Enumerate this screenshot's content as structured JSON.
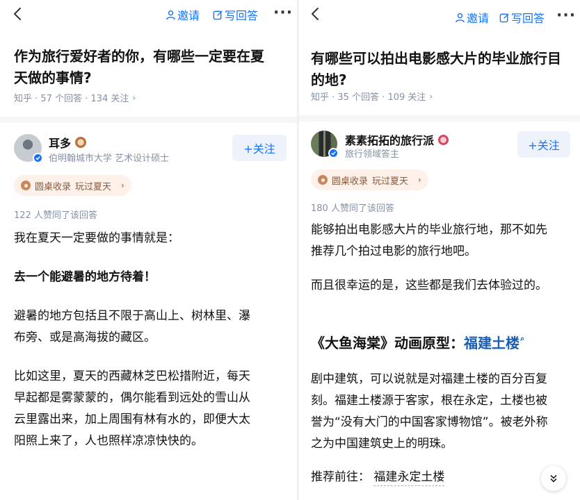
{
  "left": {
    "toolbar": {
      "invite_label": "邀请",
      "write_label": "写回答",
      "more_label": "···"
    },
    "question": {
      "title_line1": "作为旅行爱好者的你，有哪些一定要在夏",
      "title_line2": "天做的事情?",
      "meta": "知乎 · 57 个回答 · 134 关注"
    },
    "author": {
      "name": "耳多",
      "subtitle": "伯明翰城市大学 艺术设计硕士",
      "follow_label": "+关注"
    },
    "collection": {
      "label": "圆桌收录",
      "topic": "玩过夏天"
    },
    "likes": "122 人赞同了该回答",
    "answer": {
      "p1": "我在夏天一定要做的事情就是：",
      "p2": "去一个能避暑的地方待着！",
      "p3_line1": "避暑的地方包括且不限于高山上、树林里、瀑",
      "p3_line2": "布旁、或是高海拔的藏区。",
      "p4_line1": "比如这里，夏天的西藏林芝巴松措附近，每天",
      "p4_line2": "早起都是雾蒙蒙的，偶尔能看到远处的雪山从",
      "p4_line3": "云里露出来，加上周围有林有水的，即便大太",
      "p4_line4": "阳照上来了，人也照样凉凉快快的。"
    }
  },
  "right": {
    "toolbar": {
      "invite_label": "邀请",
      "write_label": "写回答",
      "more_label": "···"
    },
    "question": {
      "title_line1": "有哪些可以拍出电影感大片的毕业旅行目",
      "title_line2": "的地?",
      "meta": "知乎 · 35 个回答 · 109 关注"
    },
    "author": {
      "name": "素素拓拓的旅行派",
      "subtitle": "旅行领域答主",
      "follow_label": "+关注"
    },
    "collection": {
      "label": "圆桌收录",
      "topic": "玩过夏天"
    },
    "likes": "180 人赞同了该回答",
    "answer": {
      "p1_line1": "能够拍出电影感大片的毕业旅行地，那不如先",
      "p1_line2": "推荐几个拍过电影的旅行地吧。",
      "p2": "而且很幸运的是，这些都是我们去体验过的。",
      "heading_prefix": "《大鱼海棠》动画原型：",
      "heading_link": "福建土楼",
      "p3_line1": "剧中建筑，可以说就是对福建土楼的百分百复",
      "p3_line2": "刻。福建土楼源于客家，根在永定，土楼也被",
      "p3_line3": "誉为“没有大门的中国客家博物馆”。被老外称",
      "p3_line4": "之为中国建筑史上的明珠。",
      "recommend_prefix": "推荐前往：",
      "recommend_place": "福建永定土楼"
    }
  },
  "colors": {
    "accent": "#1772f6",
    "muted": "#8590a6",
    "collect_bg": "#fdf1e9",
    "follow_bg": "#eef3fb"
  }
}
